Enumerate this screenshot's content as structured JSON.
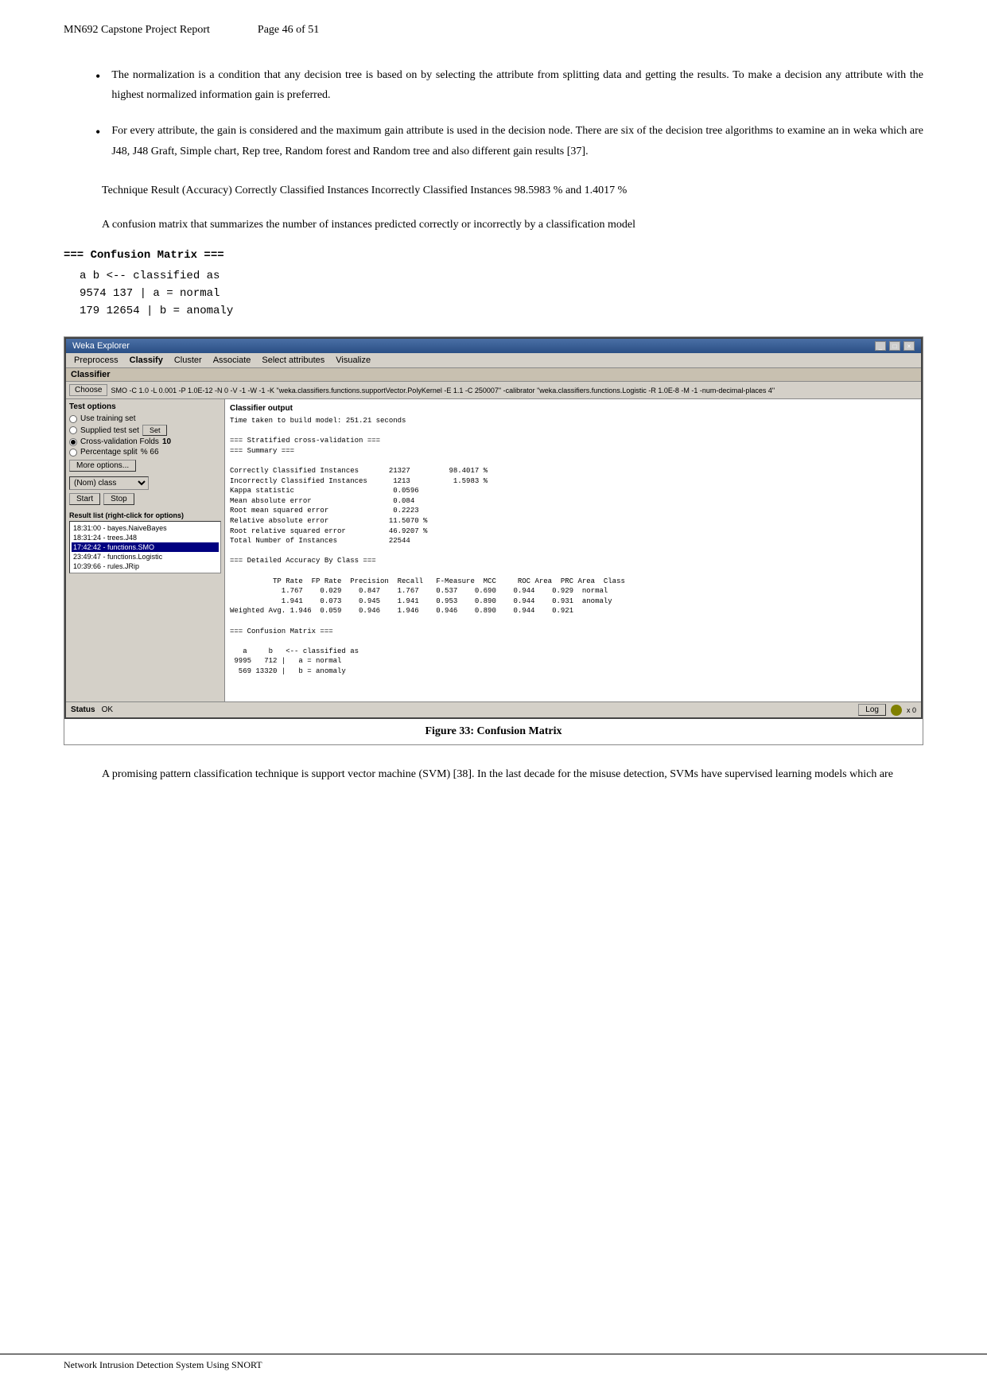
{
  "header": {
    "title": "MN692 Capstone Project Report",
    "page_label": "Page 46 of 51"
  },
  "bullets": [
    {
      "text": "The normalization is a condition that any decision tree is based on by selecting the attribute from splitting data and getting the results. To make a decision any attribute with the highest normalized information gain is preferred."
    },
    {
      "text": "For every attribute, the gain is considered and the maximum gain attribute is used in the decision node. There are six of the decision tree algorithms to examine an in weka which are J48, J48 Graft, Simple chart, Rep tree, Random forest and Random tree and also different gain results [37]."
    }
  ],
  "paragraph1": "Technique Result (Accuracy) Correctly Classified Instances Incorrectly Classified Instances 98.5983 % and 1.4017 %",
  "paragraph2": "A confusion matrix that summarizes the number of instances predicted correctly or incorrectly by a classification model",
  "confusion_header": "=== Confusion Matrix ===",
  "confusion_lines": [
    "a    b   <-- classified as",
    "9574   137 |    a = normal",
    " 179 12654 |    b = anomaly"
  ],
  "figure": {
    "caption": "Figure 33: Confusion Matrix",
    "weka": {
      "titlebar": "Weka Explorer",
      "tabs": [
        "Preprocess",
        "Classify",
        "Cluster",
        "Associate",
        "Select attributes",
        "Visualize"
      ],
      "active_tab": "Classify",
      "section_label": "Classifier",
      "choose_label": "Choose",
      "choose_value": "SMO -C 1.0 -L 0.001 -P 1.0E-12 -N 0 -V -1 -W -1 -K \"weka.classifiers.functions.supportVector.PolyKernel -E 1.1 -C 250007\" -calibrator \"weka.classifiers.functions.Logistic -R 1.0E-8 -M -1 -num-decimal-places 4\"",
      "test_options_label": "Test options",
      "classifier_output_label": "Classifier output",
      "radio_options": [
        {
          "label": "Use training set",
          "checked": false
        },
        {
          "label": "Supplied test set",
          "checked": false,
          "btn": "Set"
        },
        {
          "label": "Cross-validation Folds 10",
          "checked": true
        },
        {
          "label": "Percentage split",
          "checked": false,
          "value": "% 66"
        }
      ],
      "more_options_btn": "More options...",
      "class_label": "(Nom) class",
      "start_btn": "Start",
      "stop_btn": "Stop",
      "result_list_label": "Result list (right-click for options)",
      "result_items": [
        "18:31:00 - bayes.NaiveBayes",
        "18:31:24 - trees.J48",
        "17:42:42 - functions.SMO",
        "23:49:47 - functions.Logistic",
        "10:39:66 - rules.JRip"
      ],
      "output_lines": [
        "Time taken to build model: 251.21 seconds",
        "",
        "=== Stratified cross-validation ===",
        "=== Summary ===",
        "",
        "Correctly Classified Instances          21327              98.4017 %",
        "Incorrectly Classified Instances         1213               1.5983 %",
        "Kappa statistic                          0.0596",
        "Mean absolute error                      0.084",
        "Root mean squared error                  0.2223",
        "Relative absolute error                 11.5070 %",
        "Root relative squared error             46.9207 %",
        "Total Number of Instances               22544",
        "",
        "=== Detailed Accuracy By Class ===",
        "",
        "                 TP Rate  FP Rate  Precision  Recall   F-Measure  MCC      ROC Area  PRC Area  Class",
        "                   1.767    0.029    0.847    1.767    0.537    0.690    0.944    0.929   normal",
        "                   1.941    0.073    0.945    1.941    0.953    0.890    0.944    0.931   anomaly",
        "Weighted Avg.      1.946    0.059    0.946    1.946    0.946    0.890    0.944    0.921",
        "",
        "=== Confusion Matrix ===",
        "",
        "   a    b   <-- classified as",
        " 9995  712 |   a = normal",
        "  569 13320 |   b = anomaly"
      ],
      "status_label": "Status",
      "status_ok": "OK",
      "log_btn": "Log"
    }
  },
  "paragraph3": "A promising pattern classification technique is support vector machine (SVM) [38]. In the last decade for the misuse detection, SVMs have supervised learning models which are",
  "footer": "Network Intrusion Detection System Using SNORT"
}
